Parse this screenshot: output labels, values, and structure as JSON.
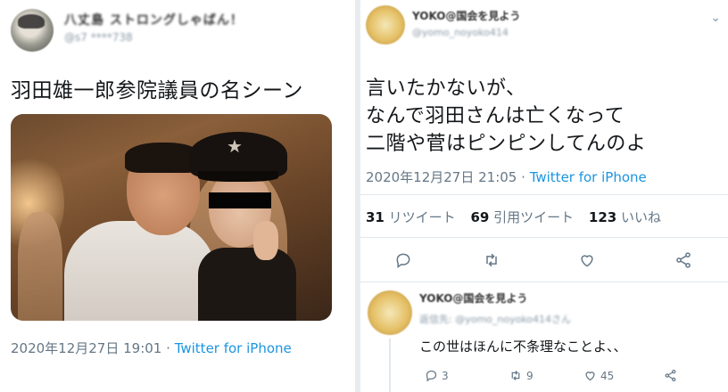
{
  "left_tweet": {
    "author_name": "八丈島 ストロングしゃばん！",
    "author_handle": "@s7 ****738",
    "text": "羽田雄一郎参院議員の名シーン",
    "timestamp": "2020年12月27日 19:01",
    "separator": "·",
    "source": "Twitter for iPhone"
  },
  "right_tweet": {
    "author_name": "YOKO@国会を見よう",
    "author_handle": "@yomo_noyoko414",
    "menu_glyph": "⌄",
    "text_lines": [
      "言いたかないが、",
      "なんで羽田さんは亡くなって",
      "二階や菅はピンピンしてんのよ"
    ],
    "timestamp": "2020年12月27日 21:05",
    "separator": "·",
    "source": "Twitter for iPhone",
    "stats": {
      "retweets_count": "31",
      "retweets_label": "リツイート",
      "quotes_count": "69",
      "quotes_label": "引用ツイート",
      "likes_count": "123",
      "likes_label": "いいね"
    }
  },
  "reply": {
    "author_name": "YOKO@国会を見よう",
    "meta": "返信先: @yomo_noyoko414さん",
    "text": "この世はほんに不条理なことよ、、",
    "reply_count": "3",
    "retweet_count": "9",
    "like_count": "45"
  },
  "colors": {
    "link": "#1b95e0",
    "muted": "#657786",
    "text": "#14171a",
    "divider": "#e1e8ed"
  }
}
